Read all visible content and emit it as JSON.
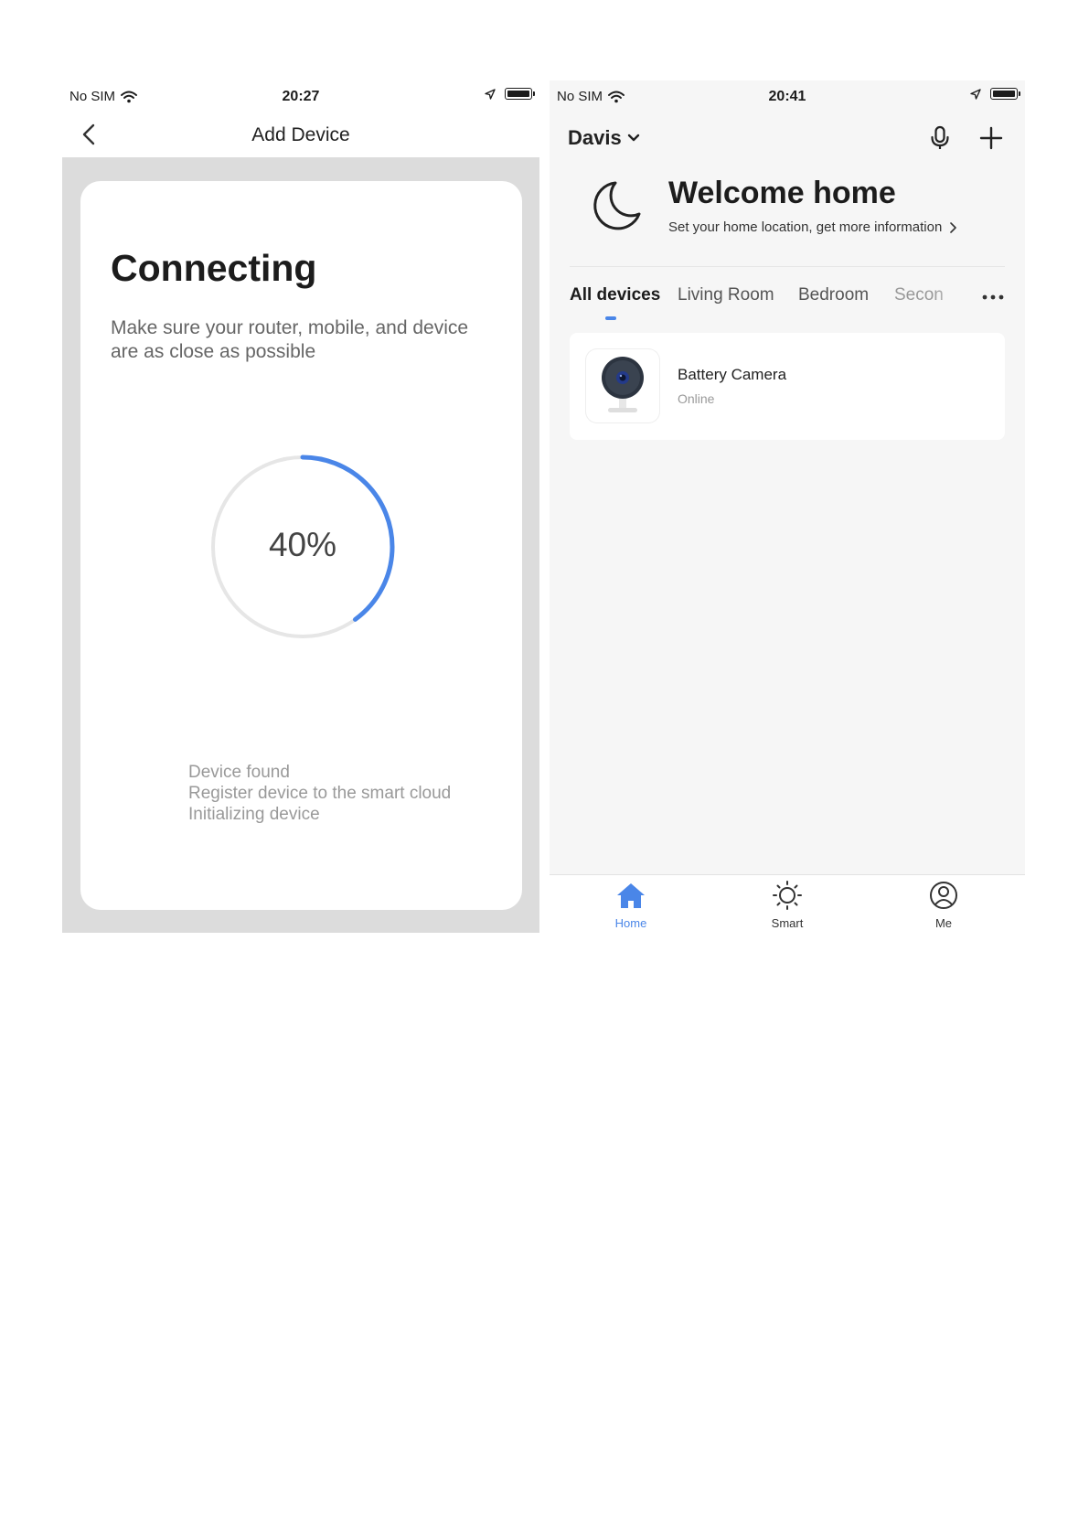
{
  "left_screen": {
    "status_bar": {
      "carrier": "No SIM",
      "time": "20:27"
    },
    "nav": {
      "title": "Add Device"
    },
    "connecting": {
      "heading": "Connecting",
      "subtitle": "Make sure your router, mobile, and device are as close as possible",
      "progress_percent": 40,
      "progress_label": "40%",
      "progress_color": "#4a86e8",
      "steps": [
        "Device found",
        "Register device to the smart cloud",
        "Initializing device"
      ]
    }
  },
  "right_screen": {
    "status_bar": {
      "carrier": "No SIM",
      "time": "20:41"
    },
    "header": {
      "home_name": "Davis"
    },
    "welcome": {
      "title": "Welcome home",
      "subtitle": "Set your home location, get more information"
    },
    "room_tabs": [
      {
        "label": "All devices",
        "active": true
      },
      {
        "label": "Living Room",
        "active": false
      },
      {
        "label": "Bedroom",
        "active": false
      },
      {
        "label": "Secon",
        "active": false
      }
    ],
    "devices": [
      {
        "name": "Battery Camera",
        "status": "Online"
      }
    ],
    "bottom_tabs": [
      {
        "label": "Home",
        "icon": "home-icon",
        "active": true
      },
      {
        "label": "Smart",
        "icon": "sun-icon",
        "active": false
      },
      {
        "label": "Me",
        "icon": "profile-icon",
        "active": false
      }
    ],
    "accent_color": "#4a86e8"
  }
}
